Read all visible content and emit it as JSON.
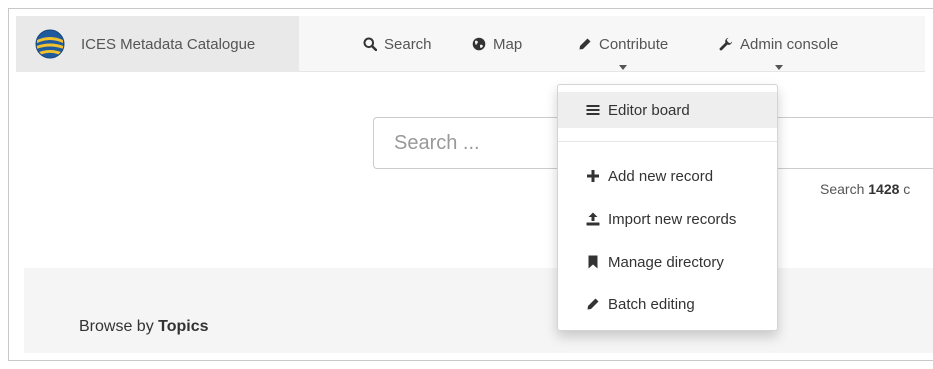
{
  "navbar": {
    "brand": {
      "title": "ICES Metadata Catalogue",
      "logo_icon": "ices-globe-logo"
    },
    "items": [
      {
        "label": "Search",
        "icon": "search-icon"
      },
      {
        "label": "Map",
        "icon": "globe-icon"
      },
      {
        "label": "Contribute",
        "icon": "pencil-icon",
        "has_caret": true,
        "open": true
      },
      {
        "label": "Admin console",
        "icon": "wrench-icon",
        "has_caret": true
      }
    ]
  },
  "search": {
    "placeholder": "Search ...",
    "count_prefix": "Search ",
    "count_value": "1428"
  },
  "browse": {
    "prefix": "Browse by ",
    "topic_label": "Topics"
  },
  "contribute_menu": {
    "items": [
      {
        "label": "Editor board",
        "icon": "list-icon",
        "active": true
      },
      {
        "label": "Add new record",
        "icon": "plus-icon"
      },
      {
        "label": "Import new records",
        "icon": "upload-icon"
      },
      {
        "label": "Manage directory",
        "icon": "bookmark-icon"
      },
      {
        "label": "Batch editing",
        "icon": "pencil-icon"
      }
    ]
  },
  "colors": {
    "navbar_bg": "#f7f7f7",
    "brand_bg": "#e9e9e9",
    "menu_active_bg": "#eeeeee",
    "logo_blue": "#1f5a9e",
    "logo_yellow": "#f2c12e"
  }
}
